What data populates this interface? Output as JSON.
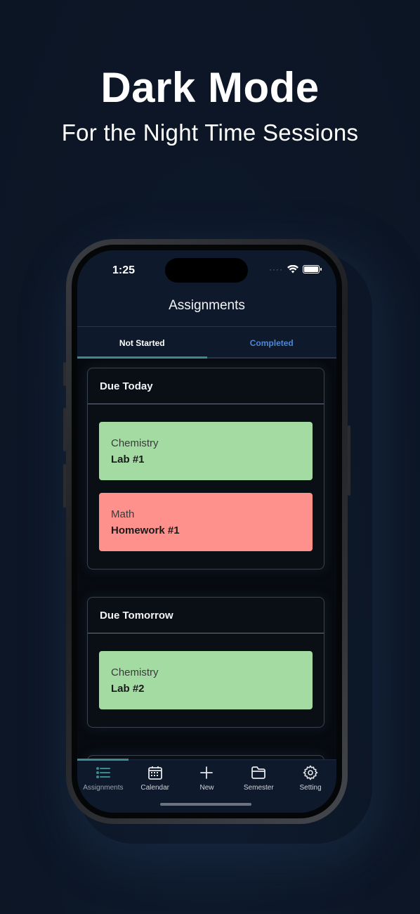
{
  "promo": {
    "headline": "Dark Mode",
    "subline": "For the Night Time Sessions"
  },
  "status": {
    "time": "1:25",
    "dots": "····"
  },
  "nav": {
    "title": "Assignments"
  },
  "tabs": [
    {
      "label": "Not Started"
    },
    {
      "label": "Completed"
    }
  ],
  "sections": [
    {
      "title": "Due Today",
      "cards": [
        {
          "subject": "Chemistry",
          "name": "Lab #1",
          "color": "#a3dba3"
        },
        {
          "subject": "Math",
          "name": "Homework #1",
          "color": "#ff918c"
        }
      ]
    },
    {
      "title": "Due Tomorrow",
      "cards": [
        {
          "subject": "Chemistry",
          "name": "Lab #2",
          "color": "#a3dba3"
        }
      ]
    }
  ],
  "tabbar": [
    {
      "label": "Assignments",
      "icon": "list-icon"
    },
    {
      "label": "Calendar",
      "icon": "calendar-icon"
    },
    {
      "label": "New",
      "icon": "plus-icon"
    },
    {
      "label": "Semester",
      "icon": "folder-icon"
    },
    {
      "label": "Setting",
      "icon": "gear-icon"
    }
  ],
  "colors": {
    "accent": "#3c8a8e",
    "link": "#4e86d6",
    "background": "#0c1626"
  }
}
